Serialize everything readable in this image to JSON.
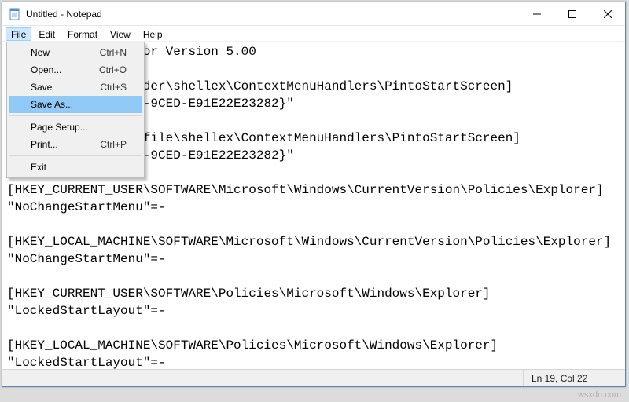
{
  "window": {
    "title": "Untitled - Notepad"
  },
  "menubar": {
    "file": "File",
    "edit": "Edit",
    "format": "Format",
    "view": "View",
    "help": "Help"
  },
  "file_menu": {
    "new": {
      "label": "New",
      "accel": "Ctrl+N"
    },
    "open": {
      "label": "Open...",
      "accel": "Ctrl+O"
    },
    "save": {
      "label": "Save",
      "accel": "Ctrl+S"
    },
    "save_as": {
      "label": "Save As...",
      "accel": ""
    },
    "page_setup": {
      "label": "Page Setup...",
      "accel": ""
    },
    "print": {
      "label": "Print...",
      "accel": "Ctrl+P"
    },
    "exit": {
      "label": "Exit",
      "accel": ""
    }
  },
  "editor": {
    "text": "               ditor Version 5.00\n\n              \\Folder\\shellex\\ContextMenuHandlers\\PintoStartScreen]\n              4d58-9CED-E91E22E23282}\"\n\n              \\exefile\\shellex\\ContextMenuHandlers\\PintoStartScreen]\n              4d58-9CED-E91E22E23282}\"\n\n[HKEY_CURRENT_USER\\SOFTWARE\\Microsoft\\Windows\\CurrentVersion\\Policies\\Explorer]\n\"NoChangeStartMenu\"=-\n\n[HKEY_LOCAL_MACHINE\\SOFTWARE\\Microsoft\\Windows\\CurrentVersion\\Policies\\Explorer]\n\"NoChangeStartMenu\"=-\n\n[HKEY_CURRENT_USER\\SOFTWARE\\Policies\\Microsoft\\Windows\\Explorer]\n\"LockedStartLayout\"=-\n\n[HKEY_LOCAL_MACHINE\\SOFTWARE\\Policies\\Microsoft\\Windows\\Explorer]\n\"LockedStartLayout\"=-"
  },
  "status": {
    "position": "Ln 19, Col 22"
  },
  "watermark": "wsxdn.com"
}
